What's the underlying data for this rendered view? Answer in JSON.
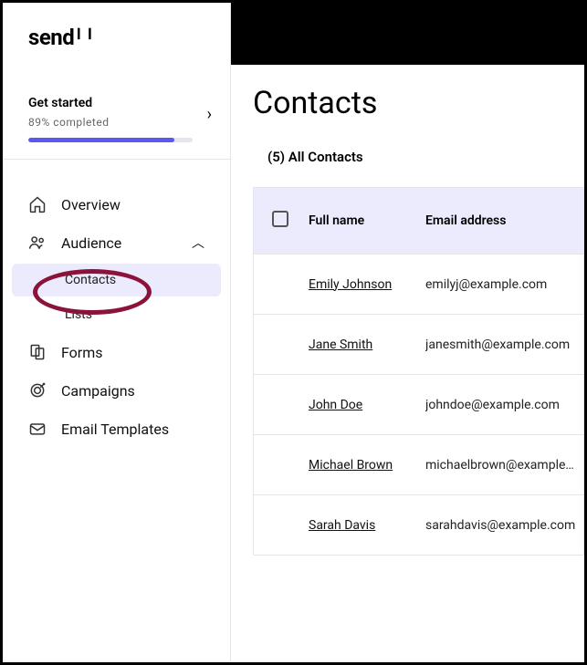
{
  "logo": {
    "text": "send"
  },
  "get_started": {
    "title": "Get started",
    "progress_pct": 89,
    "progress_label": "89% completed"
  },
  "nav": {
    "overview": "Overview",
    "audience": "Audience",
    "contacts": "Contacts",
    "lists": "Lists",
    "forms": "Forms",
    "campaigns": "Campaigns",
    "email_templates": "Email Templates"
  },
  "main": {
    "title": "Contacts",
    "list_label": "(5) All Contacts",
    "columns": {
      "name": "Full name",
      "email": "Email address"
    },
    "rows": [
      {
        "name": "Emily Johnson",
        "email": "emilyj@example.com"
      },
      {
        "name": "Jane Smith",
        "email": "janesmith@example.com"
      },
      {
        "name": "John Doe",
        "email": "johndoe@example.com"
      },
      {
        "name": "Michael Brown",
        "email": "michaelbrown@example.com"
      },
      {
        "name": "Sarah Davis",
        "email": "sarahdavis@example.com"
      }
    ]
  }
}
